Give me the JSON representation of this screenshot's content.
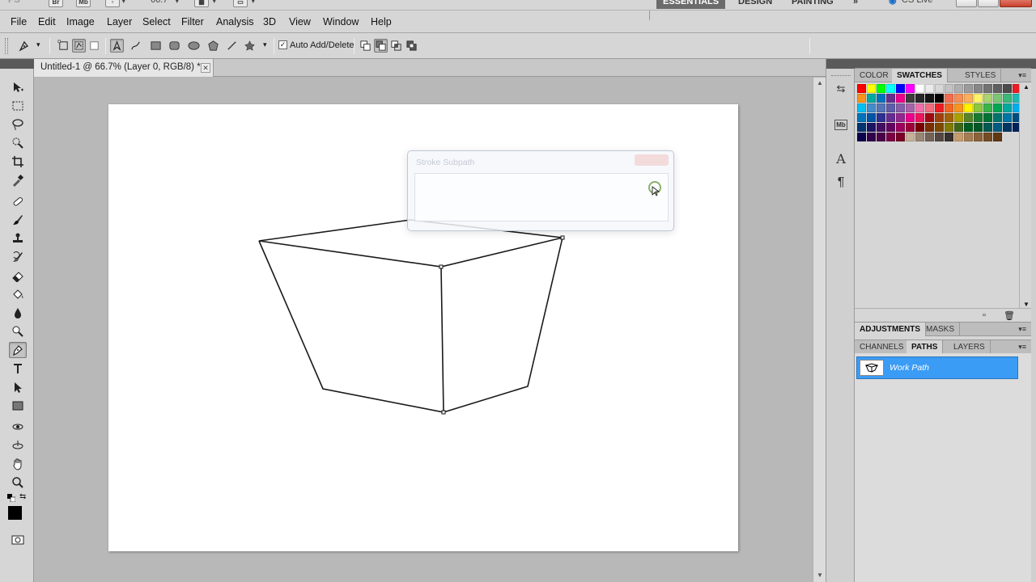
{
  "appbar": {
    "zoom_value": "66.7",
    "workspaces": [
      "ESSENTIALS",
      "DESIGN",
      "PAINTING"
    ],
    "active_workspace": "ESSENTIALS",
    "overflow": "»",
    "cslive": "CS Live"
  },
  "menu": [
    "File",
    "Edit",
    "Image",
    "Layer",
    "Select",
    "Filter",
    "Analysis",
    "3D",
    "View",
    "Window",
    "Help"
  ],
  "options": {
    "auto_add_delete_label": "Auto Add/Delete",
    "auto_add_delete_checked": true
  },
  "document": {
    "tab_title": "Untitled-1 @ 66.7% (Layer 0, RGB/8) *",
    "close_glyph": "✕"
  },
  "dialog": {
    "title": "Stroke Subpath"
  },
  "panels": {
    "group1_tabs": [
      "COLOR",
      "SWATCHES",
      "STYLES"
    ],
    "group1_active": "SWATCHES",
    "group2_tabs": [
      "ADJUSTMENTS",
      "MASKS"
    ],
    "group3_tabs": [
      "CHANNELS",
      "PATHS",
      "LAYERS"
    ],
    "group3_active": "PATHS",
    "paths": [
      {
        "name": "Work Path",
        "selected": true
      }
    ],
    "swatch_colors": [
      "#ff0000",
      "#ffff00",
      "#00ff00",
      "#00ffff",
      "#0000ff",
      "#ff00ff",
      "#ffffff",
      "#ebebeb",
      "#d7d7d7",
      "#c3c3c3",
      "#afafaf",
      "#9b9b9b",
      "#878787",
      "#737373",
      "#5f5f5f",
      "#4b4b4b",
      "#ed1c24",
      "#f7941d",
      "#00a99d",
      "#0072bc",
      "#662d91",
      "#ec008c",
      "#3c3c3c",
      "#282828",
      "#141414",
      "#000000",
      "#f26c4f",
      "#f68e55",
      "#fbaf5c",
      "#fff467",
      "#acd372",
      "#7cc576",
      "#3bb878",
      "#1abbb4",
      "#00bff3",
      "#438ccb",
      "#5574b9",
      "#605ca8",
      "#855fa8",
      "#a763a8",
      "#f06ea9",
      "#f26d7d",
      "#ed1c24",
      "#f26522",
      "#f7941d",
      "#fff200",
      "#8dc73f",
      "#39b54a",
      "#00a651",
      "#00a99d",
      "#00aeef",
      "#0072bc",
      "#0054a6",
      "#2e3192",
      "#662d91",
      "#92278f",
      "#ec008c",
      "#ed145b",
      "#9e0b0f",
      "#a0410d",
      "#a36209",
      "#aba000",
      "#598527",
      "#1a7b30",
      "#007236",
      "#00746b",
      "#0076a3",
      "#004b80",
      "#003471",
      "#1b1464",
      "#440e62",
      "#630460",
      "#9e005d",
      "#9e0039",
      "#790000",
      "#7b2e00",
      "#7d4900",
      "#827b00",
      "#406618",
      "#005e20",
      "#005826",
      "#005952",
      "#005b7f",
      "#003663",
      "#002157",
      "#0d004c",
      "#32004b",
      "#4b0049",
      "#7b0046",
      "#7a0026",
      "#c7b299",
      "#998675",
      "#736357",
      "#534741",
      "#37302d",
      "#c69c6d",
      "#a67c52",
      "#8c6239",
      "#754c24",
      "#603913"
    ]
  }
}
